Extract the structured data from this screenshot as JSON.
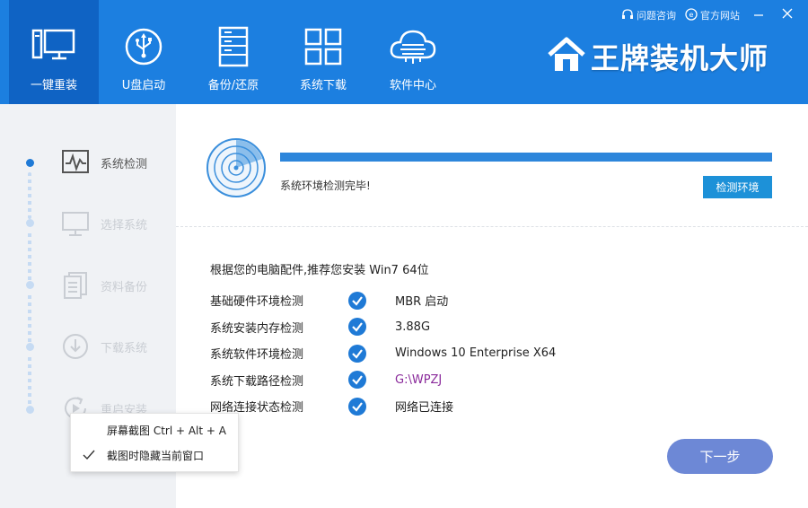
{
  "header": {
    "brand": "王牌装机大师",
    "links": [
      {
        "label": "问题咨询",
        "icon": "headset-icon"
      },
      {
        "label": "官方网站",
        "icon": "ie-icon"
      }
    ],
    "nav": [
      {
        "label": "一键重装",
        "icon": "computer-icon",
        "active": true
      },
      {
        "label": "U盘启动",
        "icon": "usb-icon"
      },
      {
        "label": "备份/还原",
        "icon": "server-icon"
      },
      {
        "label": "系统下载",
        "icon": "grid-icon"
      },
      {
        "label": "软件中心",
        "icon": "cloud-icon"
      }
    ]
  },
  "sidebar": {
    "steps": [
      {
        "label": "系统检测",
        "icon": "pulse-monitor-icon",
        "active": true
      },
      {
        "label": "选择系统",
        "icon": "monitor-icon"
      },
      {
        "label": "资料备份",
        "icon": "document-icon"
      },
      {
        "label": "下载系统",
        "icon": "download-icon"
      },
      {
        "label": "重启安装",
        "icon": "restart-icon"
      }
    ]
  },
  "main": {
    "progress": 1.0,
    "progress_text": "系统环境检测完毕!",
    "env_button": "检测环境",
    "recommend": "根据您的电脑配件,推荐您安装 Win7 64位",
    "rows": [
      {
        "label": "基础硬件环境检测",
        "value": "MBR 启动"
      },
      {
        "label": "系统安装内存检测",
        "value": "3.88G"
      },
      {
        "label": "系统软件环境检测",
        "value": "Windows 10 Enterprise X64"
      },
      {
        "label": "系统下载路径检测",
        "value": "G:\\WPZJ"
      },
      {
        "label": "网络连接状态检测",
        "value": "网络已连接"
      }
    ],
    "next_button": "下一步"
  },
  "context_menu": {
    "items": [
      {
        "label": "屏幕截图 Ctrl + Alt + A",
        "checked": false
      },
      {
        "label": "截图时隐藏当前窗口",
        "checked": true
      }
    ]
  },
  "colors": {
    "header": "#1c7fe0",
    "nav_active": "#0f63c4",
    "progress": "#2d86db",
    "check": "#1f7ad6",
    "next_button": "#6d88d6"
  }
}
